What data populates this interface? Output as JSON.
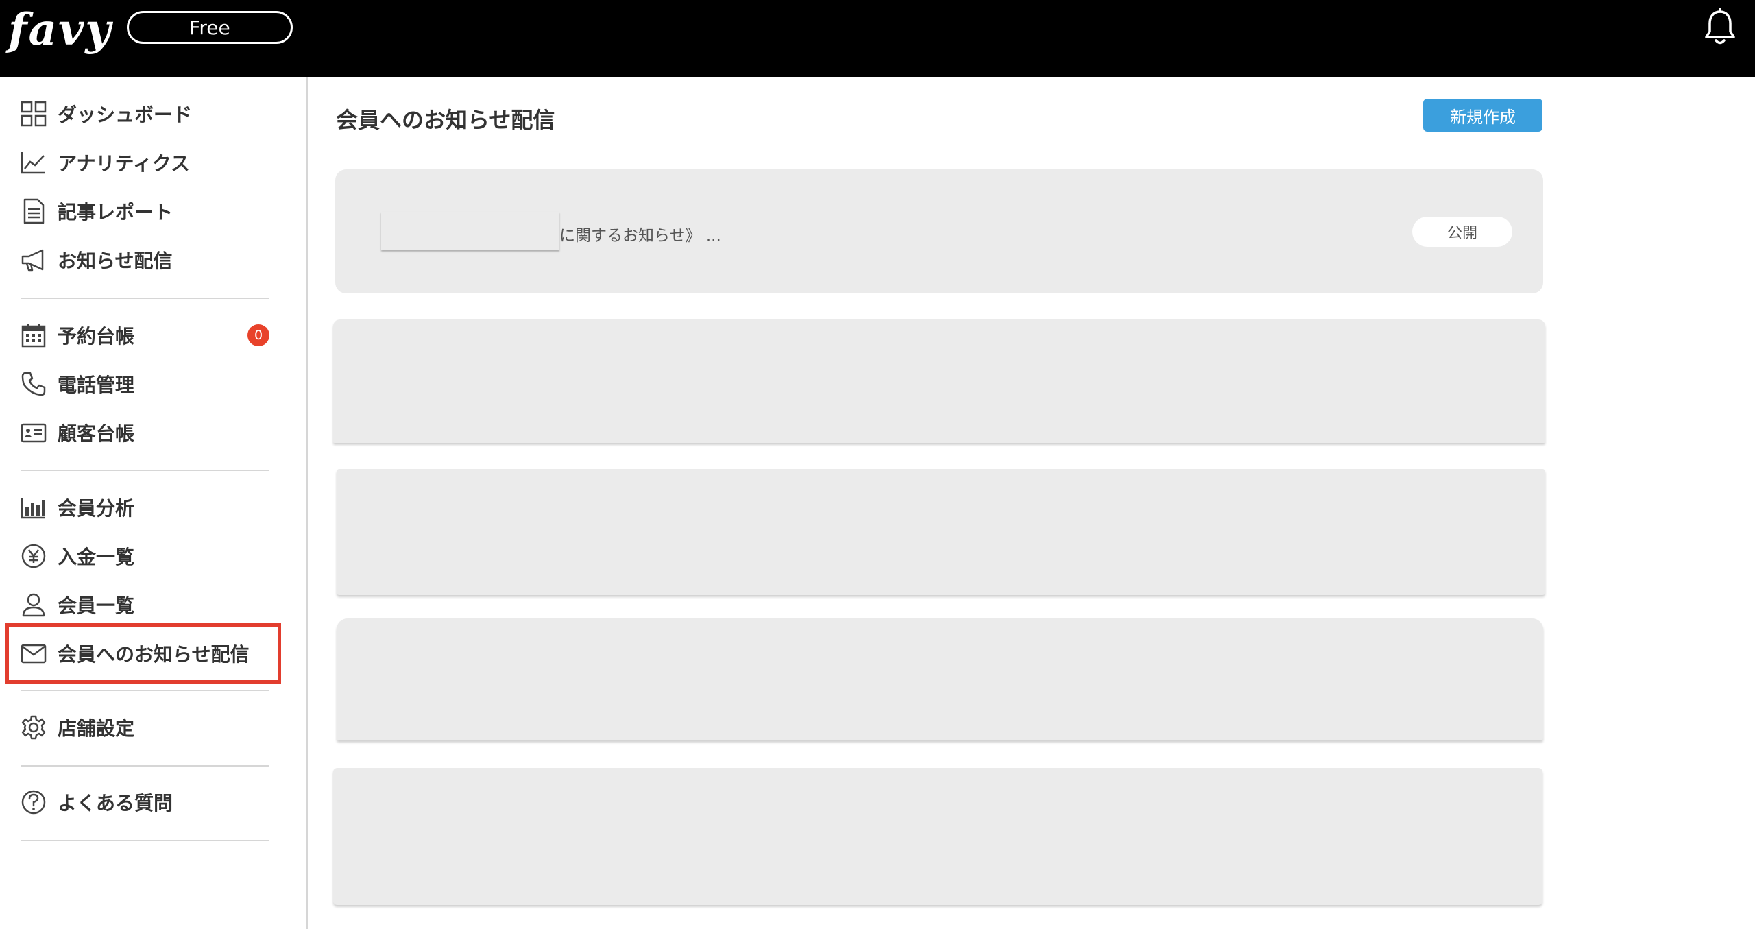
{
  "header": {
    "logo": "favy",
    "plan_badge": "Free",
    "bell_icon": "bell-icon"
  },
  "sidebar": {
    "items": [
      {
        "label": "ダッシュボード",
        "icon": "dashboard-grid-icon"
      },
      {
        "label": "アナリティクス",
        "icon": "line-chart-icon"
      },
      {
        "label": "記事レポート",
        "icon": "document-icon"
      },
      {
        "label": "お知らせ配信",
        "icon": "megaphone-icon"
      },
      {
        "label": "予約台帳",
        "icon": "calendar-icon"
      },
      {
        "label": "電話管理",
        "icon": "phone-icon"
      },
      {
        "label": "顧客台帳",
        "icon": "id-card-icon"
      },
      {
        "label": "会員分析",
        "icon": "bar-chart-icon"
      },
      {
        "label": "入金一覧",
        "icon": "yen-icon"
      },
      {
        "label": "会員一覧",
        "icon": "user-icon"
      },
      {
        "label": "会員へのお知らせ配信",
        "icon": "mail-icon"
      },
      {
        "label": "店舗設定",
        "icon": "gear-icon"
      },
      {
        "label": "よくある質問",
        "icon": "help-icon"
      }
    ],
    "reservation_badge": "0",
    "highlight_color": "#e23d2e"
  },
  "main": {
    "title": "会員へのお知らせ配信",
    "new_button": "新規作成",
    "notice": {
      "open_bracket": "《",
      "text": "に関するお知らせ》 ...",
      "status": "公開"
    }
  },
  "colors": {
    "header_bg": "#000000",
    "accent": "#3b9fdd",
    "badge": "#e8422a",
    "card_bg": "#ebebeb"
  }
}
